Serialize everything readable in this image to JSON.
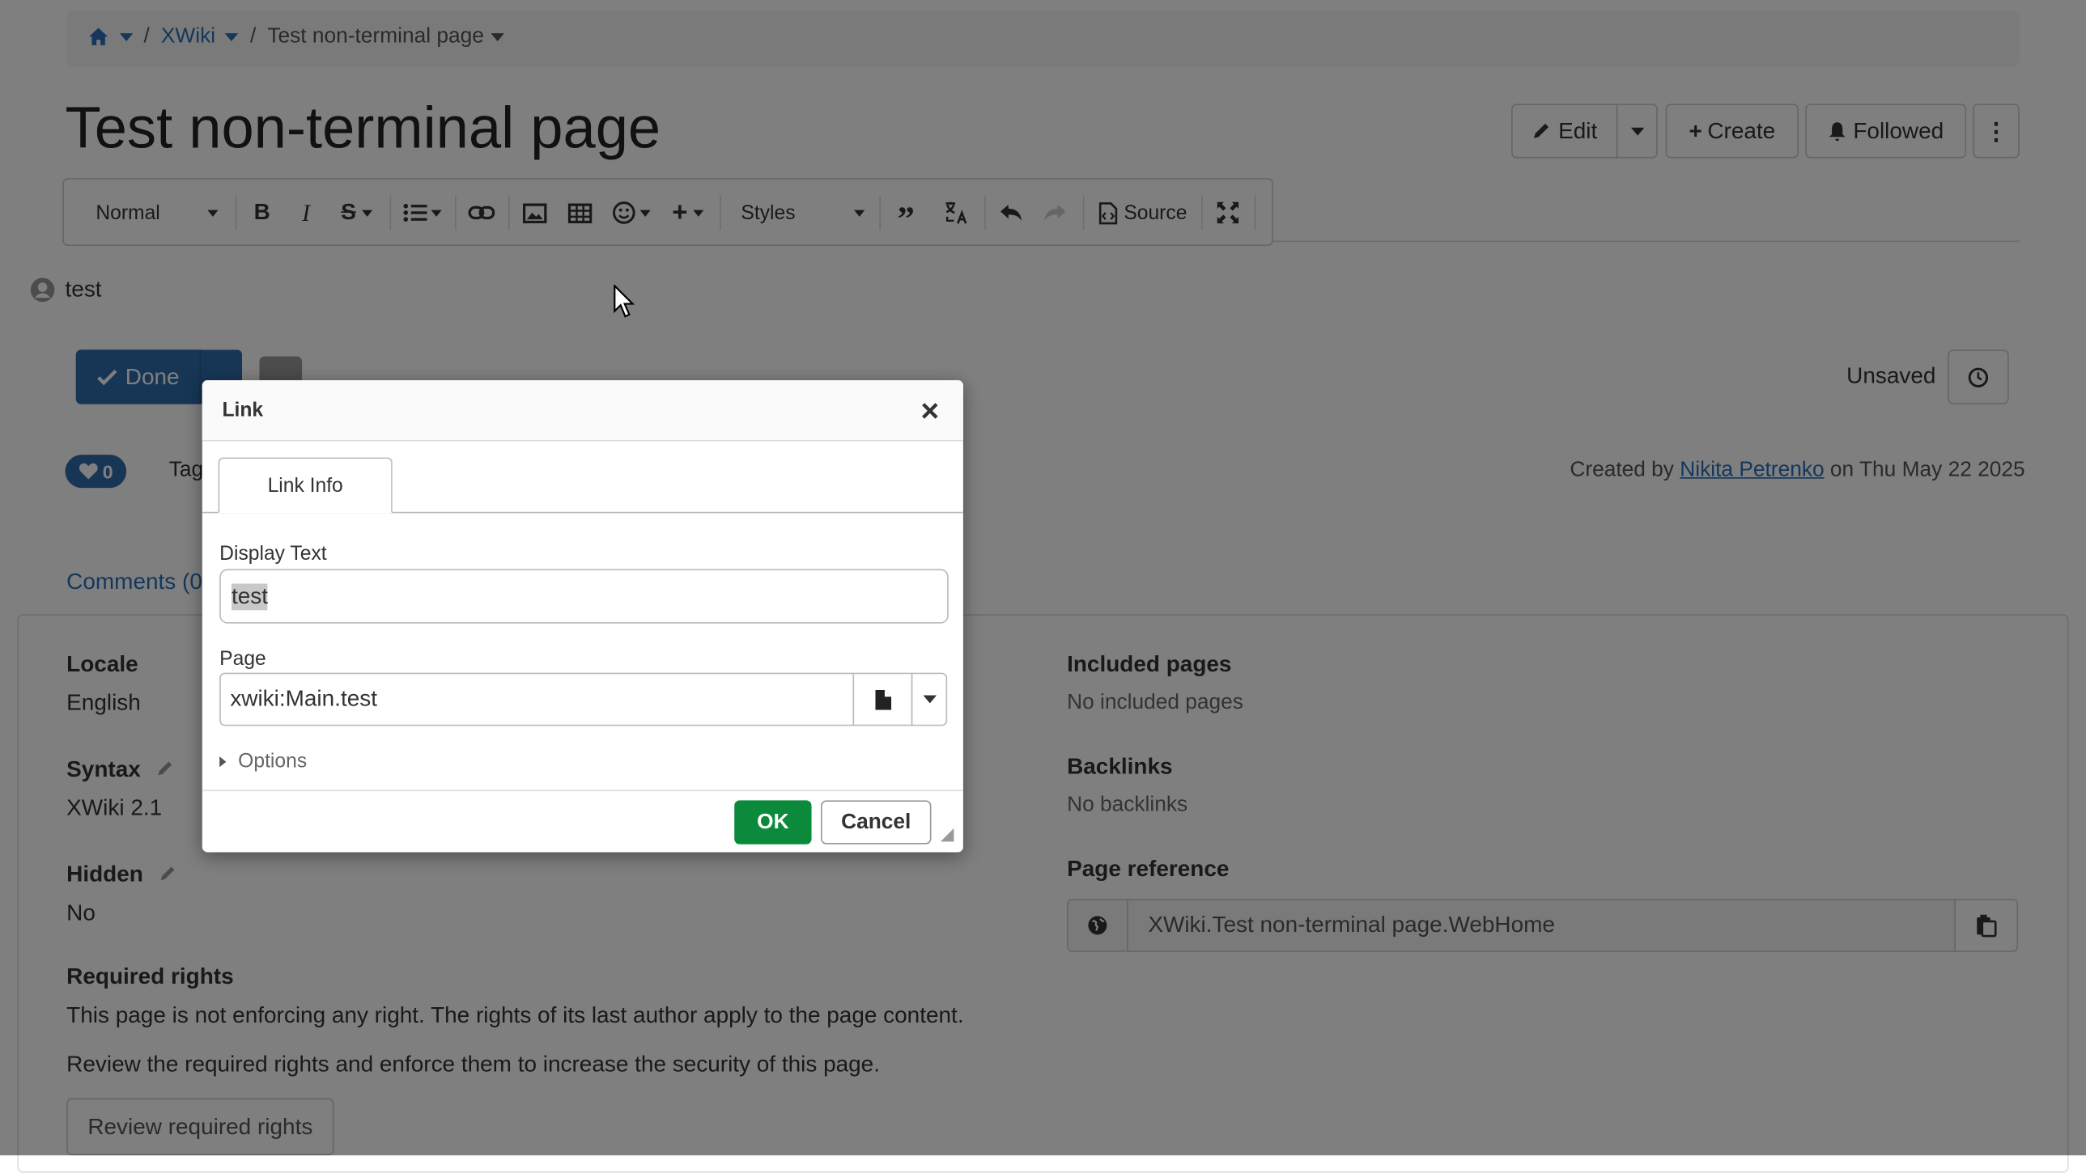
{
  "breadcrumb": {
    "wiki": "XWiki",
    "page": "Test non-terminal page"
  },
  "page_title": "Test non-terminal page",
  "actions": {
    "edit": "Edit",
    "create": "Create",
    "followed": "Followed"
  },
  "toolbar": {
    "format": "Normal",
    "styles": "Styles",
    "source": "Source"
  },
  "editor": {
    "content": "test"
  },
  "edit_bar": {
    "done": "Done",
    "status": "Unsaved"
  },
  "meta": {
    "likes": "0",
    "tags_label": "Tag",
    "created_prefix": "Created by",
    "author": "Nikita Petrenko",
    "created_suffix": "on Thu May 22 2025"
  },
  "tabs": {
    "comments": "Comments (0"
  },
  "info": {
    "locale_label": "Locale",
    "locale_value": "English",
    "syntax_label": "Syntax",
    "syntax_value": "XWiki 2.1",
    "hidden_label": "Hidden",
    "hidden_value": "No",
    "rights_label": "Required rights",
    "rights_text1": "This page is not enforcing any right. The rights of its last author apply to the page content.",
    "rights_text2": "Review the required rights and enforce them to increase the security of this page.",
    "review_button": "Review required rights",
    "included_label": "Included pages",
    "included_value": "No included pages",
    "backlinks_label": "Backlinks",
    "backlinks_value": "No backlinks",
    "reference_label": "Page reference",
    "reference_value": "XWiki.Test non-terminal page.WebHome"
  },
  "dialog": {
    "title": "Link",
    "tab": "Link Info",
    "display_text_label": "Display Text",
    "display_text_value": "test",
    "page_label": "Page",
    "page_value": "xwiki:Main.test",
    "options": "Options",
    "ok": "OK",
    "cancel": "Cancel"
  },
  "colors": {
    "primary": "#2f6dad",
    "success": "#0a8a3a",
    "link": "#2a6fb8",
    "overlay": "rgba(0,0,0,0.5)"
  }
}
